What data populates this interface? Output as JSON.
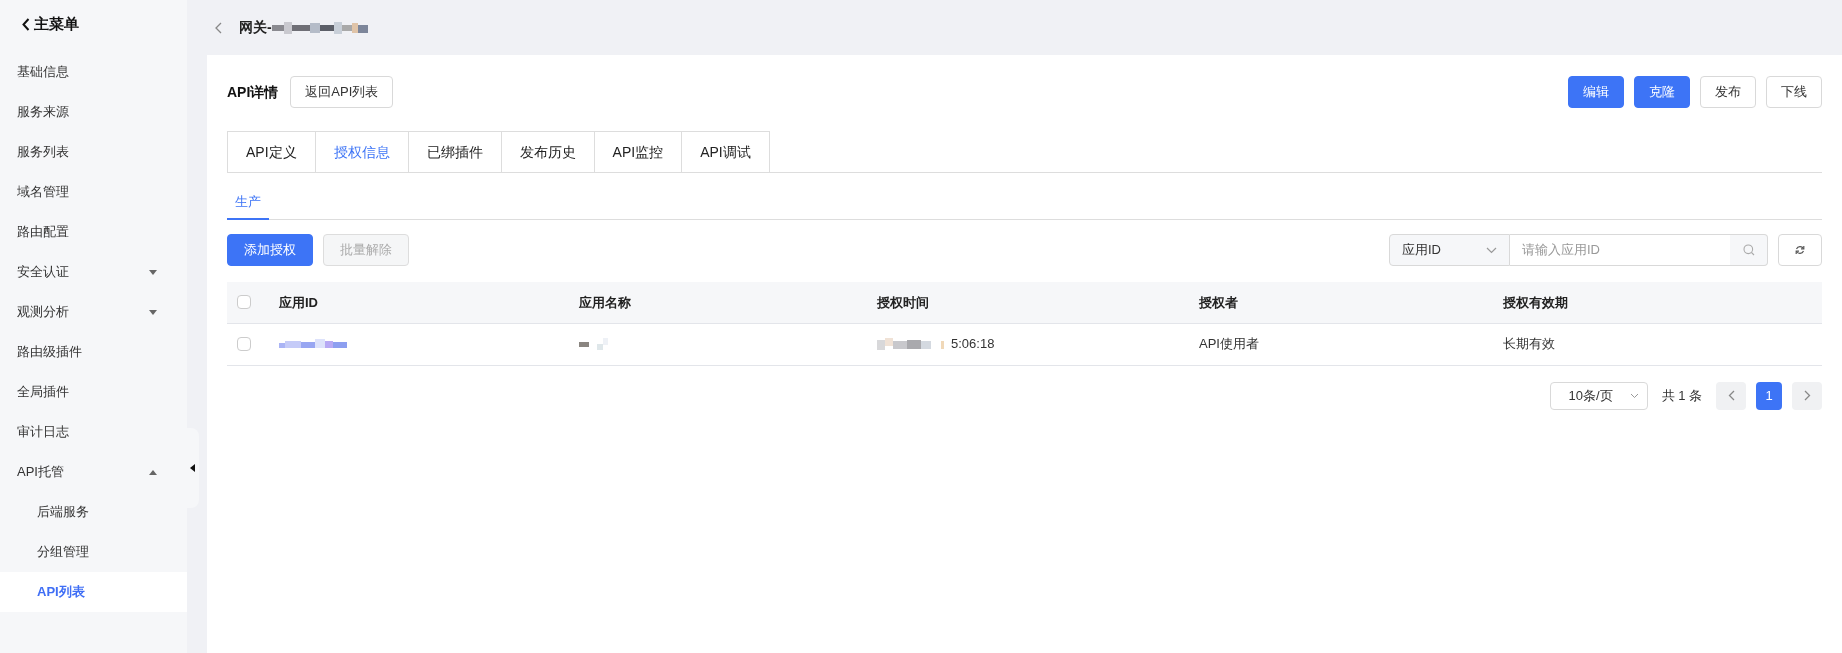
{
  "sidebar": {
    "back_label": "主菜单",
    "items": [
      {
        "label": "基础信息",
        "selected": false
      },
      {
        "label": "服务来源",
        "selected": false
      },
      {
        "label": "服务列表",
        "selected": false
      },
      {
        "label": "域名管理",
        "selected": false
      },
      {
        "label": "路由配置",
        "selected": false
      },
      {
        "label": "安全认证",
        "selected": false,
        "expanded": false
      },
      {
        "label": "观测分析",
        "selected": false,
        "expanded": false
      },
      {
        "label": "路由级插件",
        "selected": false
      },
      {
        "label": "全局插件",
        "selected": false
      },
      {
        "label": "审计日志",
        "selected": false
      },
      {
        "label": "API托管",
        "selected": false,
        "expanded": true,
        "children": [
          {
            "label": "后端服务",
            "selected": false
          },
          {
            "label": "分组管理",
            "selected": false
          },
          {
            "label": "API列表",
            "selected": true
          }
        ]
      }
    ]
  },
  "header": {
    "title": "网关-"
  },
  "page": {
    "title": "API详情",
    "back_button": "返回API列表",
    "actions": [
      {
        "label": "编辑",
        "kind": "primary"
      },
      {
        "label": "克隆",
        "kind": "primary"
      },
      {
        "label": "发布",
        "kind": "default"
      },
      {
        "label": "下线",
        "kind": "default"
      }
    ]
  },
  "tabs": [
    {
      "label": "API定义",
      "selected": false
    },
    {
      "label": "授权信息",
      "selected": true
    },
    {
      "label": "已绑插件",
      "selected": false
    },
    {
      "label": "发布历史",
      "selected": false
    },
    {
      "label": "API监控",
      "selected": false
    },
    {
      "label": "API调试",
      "selected": false
    }
  ],
  "subtabs": [
    {
      "label": "生产",
      "selected": true
    }
  ],
  "toolbar": {
    "buttons": [
      {
        "label": "添加授权",
        "disabled": false
      },
      {
        "label": "批量解除",
        "disabled": true
      }
    ],
    "filter_select": "应用ID",
    "search": {
      "placeholder": "请输入应用ID"
    }
  },
  "table": {
    "all_checked": false,
    "columns": [
      "应用ID",
      "应用名称",
      "授权时间",
      "授权者",
      "授权有效期"
    ],
    "rows": [
      {
        "checked": false,
        "cells": [
          {
            "kind": "redacted-link"
          },
          {
            "kind": "redacted"
          },
          {
            "kind": "time",
            "text": "5:06:18"
          },
          {
            "kind": "text",
            "text": "API使用者"
          },
          {
            "kind": "text",
            "text": "长期有效"
          }
        ]
      }
    ]
  },
  "pagination": {
    "page_size": "10条/页",
    "total": "共 1 条",
    "pages": [
      {
        "label": "1",
        "selected": true
      }
    ]
  }
}
